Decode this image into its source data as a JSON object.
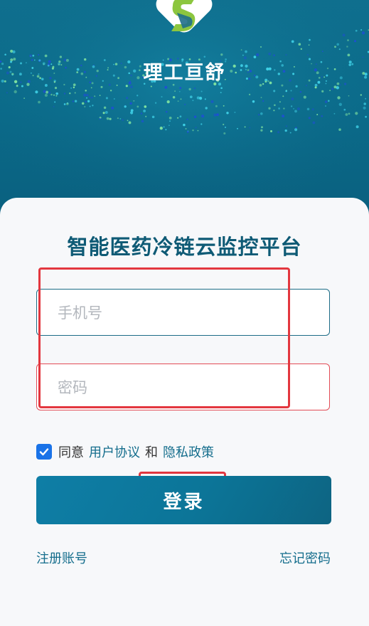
{
  "brand": {
    "name": "理工亘舒",
    "logo_icon": "s-logo-icon",
    "colors": {
      "green": "#8cc63f",
      "teal": "#0b6b8a"
    }
  },
  "title": "智能医药冷链云监控平台",
  "form": {
    "phone_placeholder": "手机号",
    "password_placeholder": "密码"
  },
  "agreement": {
    "checked": true,
    "prefix": "同意",
    "user_agreement": "用户协议",
    "and": "和",
    "privacy_policy": "隐私政策"
  },
  "login_button": "登录",
  "links": {
    "register": "注册账号",
    "forgot": "忘记密码"
  },
  "colors": {
    "accent": "#146d8c",
    "checkbox": "#1a73e8",
    "error": "#e24b55"
  }
}
